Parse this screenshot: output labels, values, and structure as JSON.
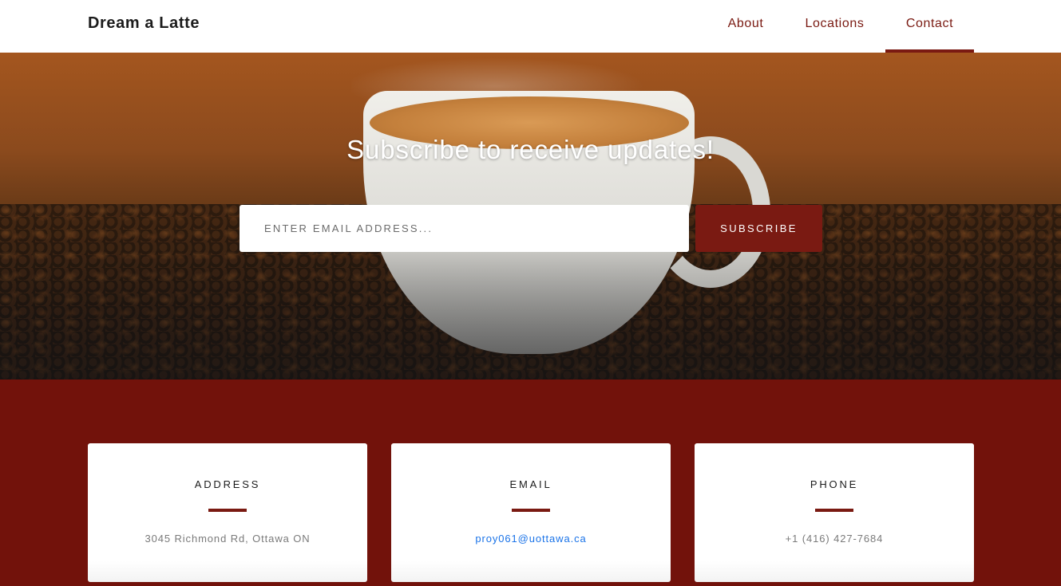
{
  "navbar": {
    "brand": "Dream a Latte",
    "links": [
      {
        "label": "About"
      },
      {
        "label": "Locations"
      },
      {
        "label": "Contact",
        "active": true
      }
    ]
  },
  "hero": {
    "title": "Subscribe to receive updates!",
    "email_placeholder": "ENTER EMAIL ADDRESS...",
    "email_value": "",
    "subscribe_label": "SUBSCRIBE"
  },
  "contact": {
    "cards": [
      {
        "title": "ADDRESS",
        "value": "3045 Richmond Rd, Ottawa ON"
      },
      {
        "title": "EMAIL",
        "value": "proy061@uottawa.ca"
      },
      {
        "title": "PHONE",
        "value": "+1 (416) 427-7684"
      }
    ]
  },
  "colors": {
    "accent": "#7a1a12",
    "section_background": "#72120b",
    "link": "#1a73e8"
  }
}
